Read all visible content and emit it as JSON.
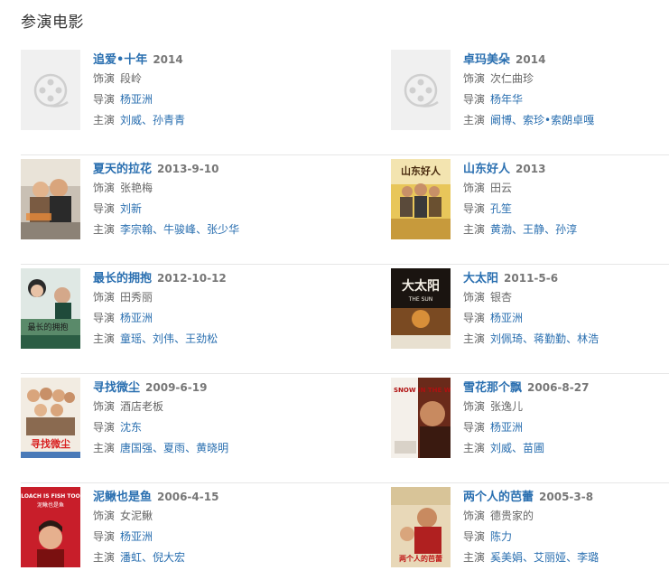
{
  "section_title": "参演电影",
  "labels": {
    "role": "饰演",
    "director": "导演",
    "cast": "主演"
  },
  "films": [
    {
      "title": "追爱•十年",
      "date": "2014",
      "role": "段岭",
      "director": [
        "杨亚洲"
      ],
      "cast": [
        "刘威",
        "孙青青"
      ],
      "poster": "placeholder"
    },
    {
      "title": "卓玛美朵",
      "date": "2014",
      "role": "次仁曲珍",
      "director": [
        "杨年华"
      ],
      "cast": [
        "阚博",
        "索珍•索朗卓嘎"
      ],
      "poster": "placeholder"
    },
    {
      "title": "夏天的拉花",
      "date": "2013-9-10",
      "role": "张艳梅",
      "director": [
        "刘新"
      ],
      "cast": [
        "李宗翰",
        "牛骏峰",
        "张少华"
      ],
      "poster": "poster-summer"
    },
    {
      "title": "山东好人",
      "date": "2013",
      "role": "田云",
      "director": [
        "孔笙"
      ],
      "cast": [
        "黄渤",
        "王静",
        "孙淳"
      ],
      "poster": "poster-shandong"
    },
    {
      "title": "最长的拥抱",
      "date": "2012-10-12",
      "role": "田秀丽",
      "director": [
        "杨亚洲"
      ],
      "cast": [
        "童瑶",
        "刘伟",
        "王劲松"
      ],
      "poster": "poster-hug"
    },
    {
      "title": "大太阳",
      "date": "2011-5-6",
      "role": "银杏",
      "director": [
        "杨亚洲"
      ],
      "cast": [
        "刘佩琦",
        "蒋勤勤",
        "林浩"
      ],
      "poster": "poster-sun"
    },
    {
      "title": "寻找微尘",
      "date": "2009-6-19",
      "role": "酒店老板",
      "director": [
        "沈东"
      ],
      "cast": [
        "唐国强",
        "夏雨",
        "黄晓明"
      ],
      "poster": "poster-dust"
    },
    {
      "title": "雪花那个飘",
      "date": "2006-8-27",
      "role": "张逸儿",
      "director": [
        "杨亚洲"
      ],
      "cast": [
        "刘威",
        "苗圃"
      ],
      "poster": "poster-snow"
    },
    {
      "title": "泥鳅也是鱼",
      "date": "2006-4-15",
      "role": "女泥鳅",
      "director": [
        "杨亚洲"
      ],
      "cast": [
        "潘虹",
        "倪大宏"
      ],
      "poster": "poster-loach"
    },
    {
      "title": "两个人的芭蕾",
      "date": "2005-3-8",
      "role": "德贵家的",
      "director": [
        "陈力"
      ],
      "cast": [
        "奚美娟",
        "艾丽娅",
        "李璐"
      ],
      "poster": "poster-ballet"
    }
  ],
  "poster_text": {
    "poster-shandong": "山东好人",
    "poster-sun": "大太阳",
    "poster-sun-sub": "THE SUN",
    "poster-dust": "寻找微尘",
    "poster-snow": "SNOW IN THE WIND",
    "poster-loach": "LOACH IS FISH TOO",
    "poster-loach-sub": "泥鳅也是鱼",
    "poster-ballet": "两个人的芭蕾"
  },
  "colors": {
    "link": "#2a6fb0",
    "divider": "#e6e6e6",
    "placeholder_bg": "#f0f0f0"
  }
}
